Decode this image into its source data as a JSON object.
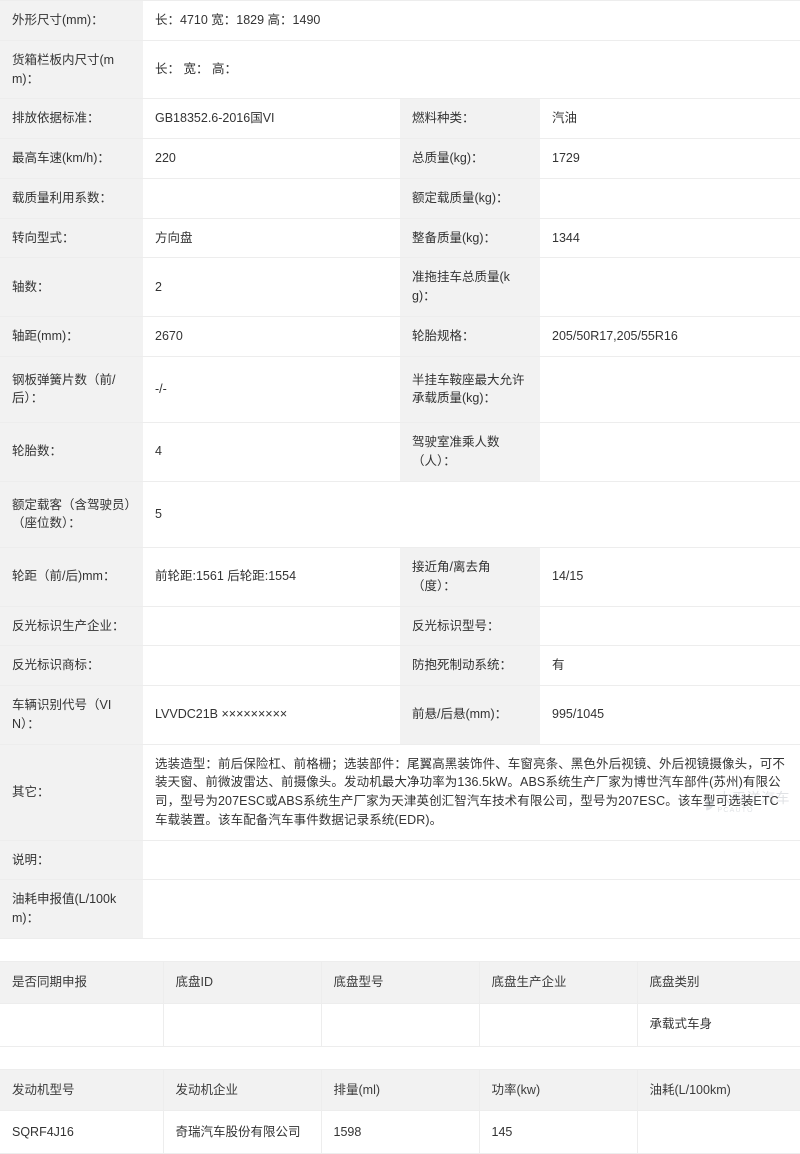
{
  "spec_rows": [
    {
      "left_label": "外形尺寸(mm)：",
      "left_value": "长：4710 宽：1829 高：1490",
      "full_width": true
    },
    {
      "left_label": "货箱栏板内尺寸(mm)：",
      "left_value": "长： 宽： 高：",
      "full_width": true
    },
    {
      "left_label": "排放依据标准：",
      "left_value": "GB18352.6-2016国VI",
      "right_label": "燃料种类：",
      "right_value": "汽油"
    },
    {
      "left_label": "最高车速(km/h)：",
      "left_value": "220",
      "right_label": "总质量(kg)：",
      "right_value": "1729"
    },
    {
      "left_label": "载质量利用系数：",
      "left_value": "",
      "right_label": "额定载质量(kg)：",
      "right_value": ""
    },
    {
      "left_label": "转向型式：",
      "left_value": "方向盘",
      "right_label": "整备质量(kg)：",
      "right_value": "1344"
    },
    {
      "left_label": "轴数：",
      "left_value": "2",
      "right_label": "准拖挂车总质量(kg)：",
      "right_value": ""
    },
    {
      "left_label": "轴距(mm)：",
      "left_value": "2670",
      "right_label": "轮胎规格：",
      "right_value": "205/50R17,205/55R16"
    },
    {
      "left_label": "钢板弹簧片数（前/后）：",
      "left_value": "-/-",
      "right_label": "半挂车鞍座最大允许承载质量(kg)：",
      "right_value": "",
      "tall": true
    },
    {
      "left_label": "轮胎数：",
      "left_value": "4",
      "right_label": "驾驶室准乘人数（人）：",
      "right_value": ""
    },
    {
      "left_label": "额定载客（含驾驶员）（座位数）：",
      "left_value": "5",
      "full_width": true,
      "tall": true
    },
    {
      "left_label": "轮距（前/后)mm：",
      "left_value": "前轮距:1561 后轮距:1554",
      "right_label": "接近角/离去角（度）：",
      "right_value": "14/15"
    },
    {
      "left_label": "反光标识生产企业：",
      "left_value": "",
      "right_label": "反光标识型号：",
      "right_value": ""
    },
    {
      "left_label": "反光标识商标：",
      "left_value": "",
      "right_label": "防抱死制动系统：",
      "right_value": "有"
    },
    {
      "left_label": "车辆识别代号（VIN）：",
      "left_value": "LVVDC21B ×××××××××",
      "right_label": "前悬/后悬(mm)：",
      "right_value": "995/1045"
    }
  ],
  "other_row": {
    "label": "其它：",
    "value": "选装造型：前后保险杠、前格栅；选装部件：尾翼高黑装饰件、车窗亮条、黑色外后视镜、外后视镜摄像头，可不装天窗、前微波雷达、前摄像头。发动机最大净功率为136.5kW。ABS系统生产厂家为博世汽车部件(苏州)有限公司，型号为207ESC或ABS系统生产厂家为天津英创汇智汽车技术有限公司，型号为207ESC。该车型可选装ETC车载装置。该车配备汽车事件数据记录系统(EDR)。"
  },
  "tail_rows": [
    {
      "label": "说明：",
      "value": ""
    },
    {
      "label": "油耗申报值(L/100km)：",
      "value": ""
    }
  ],
  "chassis_table": {
    "headers": [
      "是否同期申报",
      "底盘ID",
      "底盘型号",
      "底盘生产企业",
      "底盘类别"
    ],
    "rows": [
      [
        "",
        "",
        "",
        "",
        "承载式车身"
      ]
    ]
  },
  "engine_table": {
    "headers": [
      "发动机型号",
      "发动机企业",
      "排量(ml)",
      "功率(kw)",
      "油耗(L/100km)"
    ],
    "rows": [
      [
        "SQRF4J16",
        "奇瑞汽车股份有限公司",
        "1598",
        "145",
        ""
      ]
    ]
  },
  "watermark": {
    "mark": "◗",
    "cn": "太平洋汽车",
    "en": "PCAUTO"
  }
}
